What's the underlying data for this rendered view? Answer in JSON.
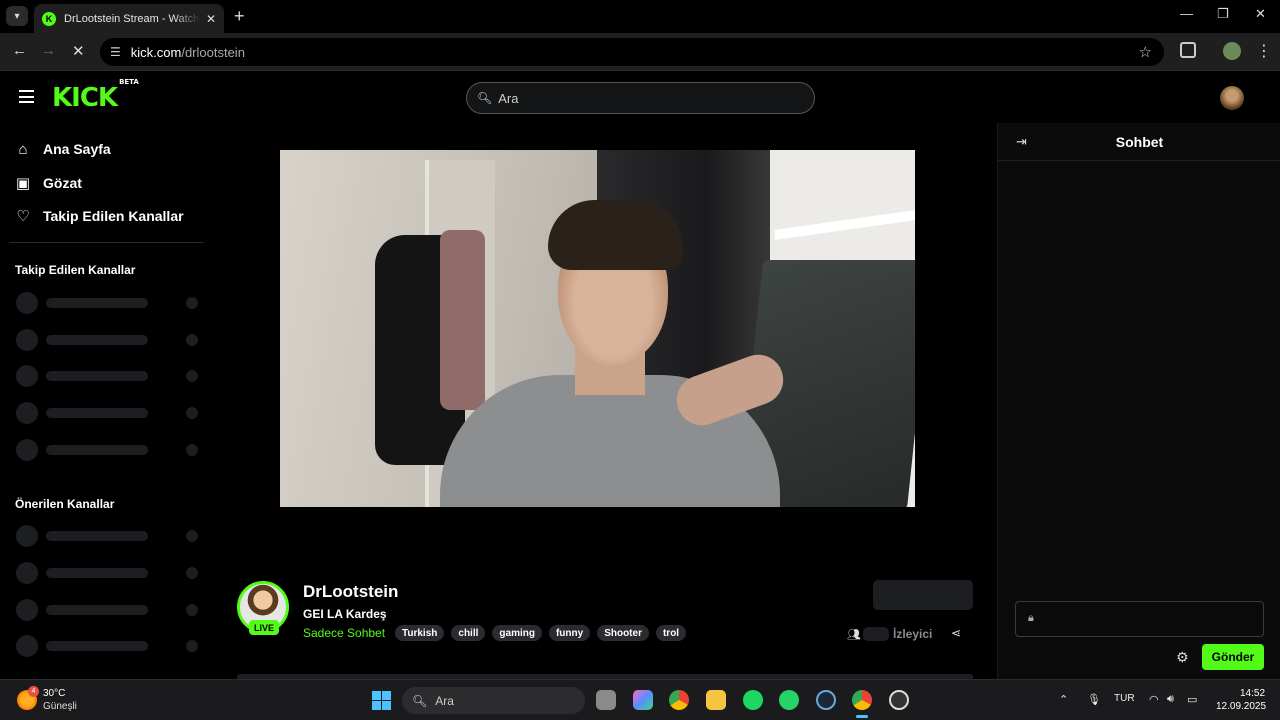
{
  "browser": {
    "tab_title": "DrLootstein Stream - Watch Live on Kick",
    "url_host": "kick.com",
    "url_path": "/drlootstein"
  },
  "header": {
    "logo": "KICK",
    "logo_badge": "BETA",
    "search_placeholder": "Ara"
  },
  "sidebar": {
    "nav": [
      {
        "label": "Ana Sayfa",
        "icon": "home-icon"
      },
      {
        "label": "Gözat",
        "icon": "browse-icon"
      },
      {
        "label": "Takip Edilen Kanallar",
        "icon": "heart-icon"
      }
    ],
    "followed_heading": "Takip Edilen Kanallar",
    "recommended_heading": "Önerilen Kanallar"
  },
  "stream": {
    "live_badge": "LIVE",
    "name": "DrLootstein",
    "title": "GEI LA Kardeş",
    "category": "Sadece Sohbet",
    "tags": [
      "Turkish",
      "chill",
      "gaming",
      "funny",
      "Shooter",
      "trol"
    ],
    "viewers_label": "İzleyici"
  },
  "chat": {
    "title": "Sohbet",
    "send_label": "Gönder"
  },
  "taskbar": {
    "weather_badge": "4",
    "temperature": "30°C",
    "weather_desc": "Güneşli",
    "search_label": "Ara",
    "language": "TUR",
    "time": "14:52",
    "date": "12.09.2025"
  },
  "colors": {
    "accent": "#53fc18",
    "background": "#000000",
    "chat_bg": "#0b0b0c",
    "tag_bg": "#2a2c30"
  }
}
